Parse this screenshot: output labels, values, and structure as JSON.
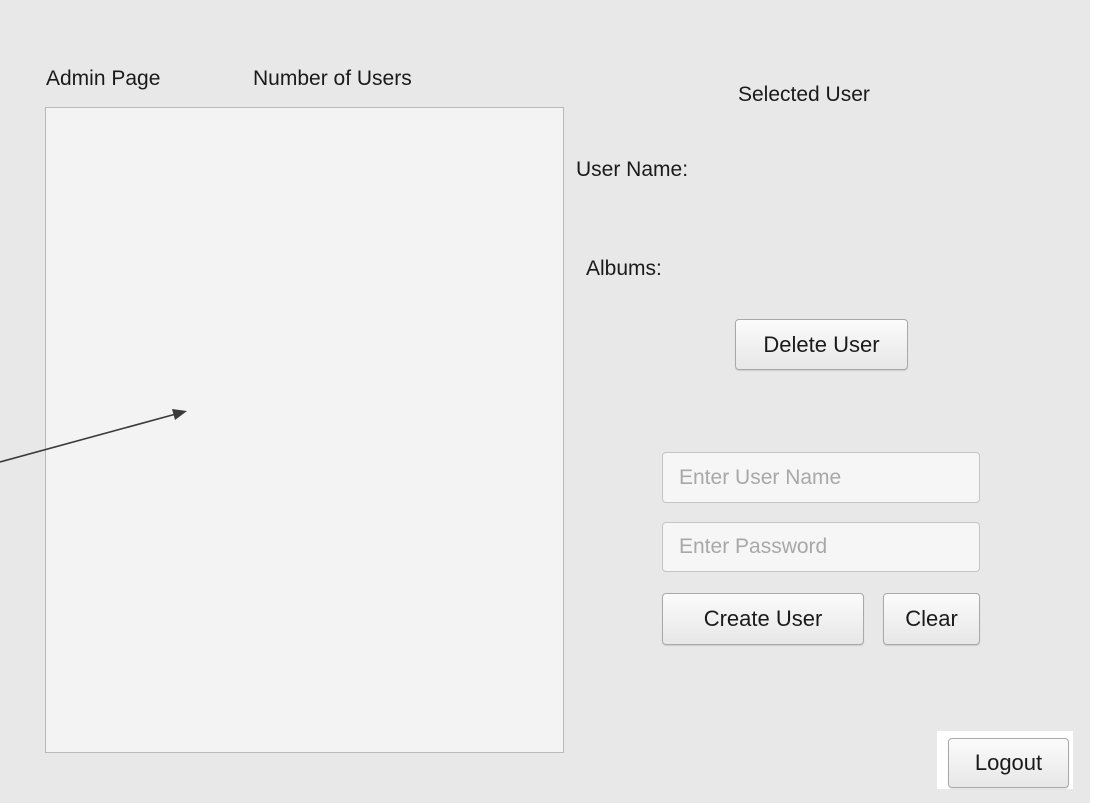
{
  "header": {
    "title": "Admin Page",
    "user_count_label": "Number of Users"
  },
  "details": {
    "heading": "Selected User",
    "user_name_label": "User Name:",
    "albums_label": "Albums:",
    "delete_label": "Delete User"
  },
  "create_form": {
    "username_placeholder": "Enter User Name",
    "username_value": "",
    "password_placeholder": "Enter Password",
    "password_value": "",
    "create_label": "Create User",
    "clear_label": "Clear"
  },
  "footer": {
    "logout_label": "Logout"
  },
  "colors": {
    "window_bg": "#e8e8e8",
    "list_bg": "#f3f3f3",
    "arrow": "#3a3a3a"
  }
}
